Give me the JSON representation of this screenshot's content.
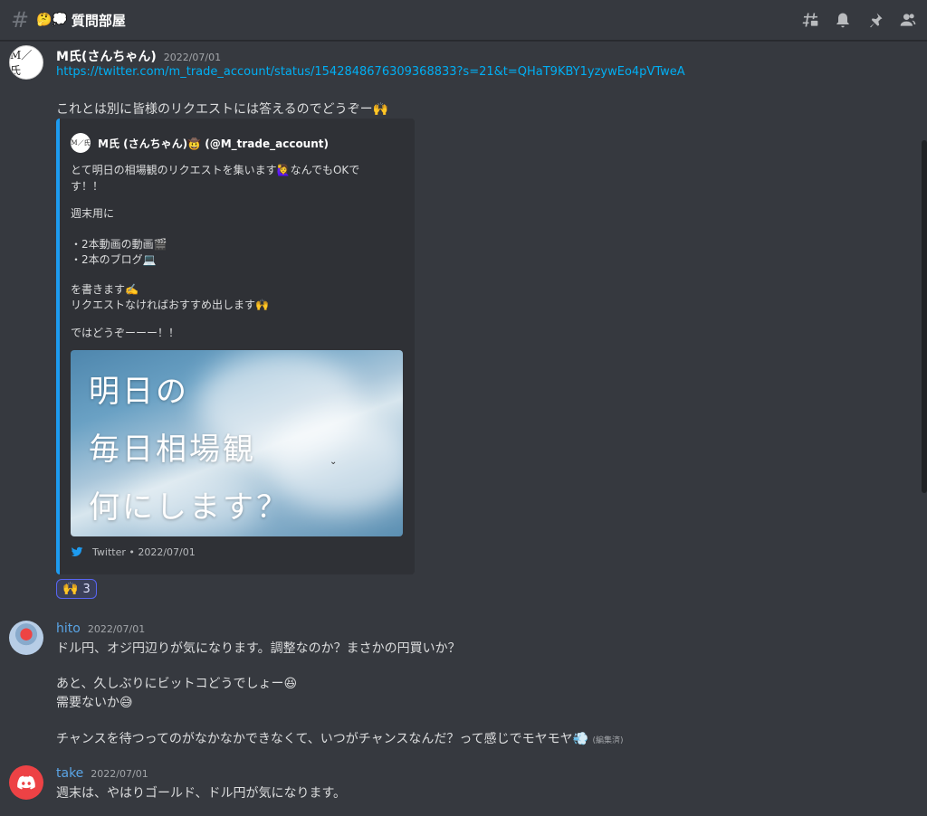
{
  "channel": {
    "emoji": "🤔💭",
    "name": "質問部屋"
  },
  "header_icons": [
    "threads-icon",
    "bell-icon",
    "pin-icon",
    "members-icon"
  ],
  "messages": [
    {
      "author": "M氏(さんちゃん)",
      "timestamp": "2022/07/01",
      "avatar_text": "M／氏",
      "link": "https://twitter.com/m_trade_account/status/1542848676309368833?s=21&t=QHaT9KBY1yzywEo4pVTweA",
      "text": "これとは別に皆様のリクエストには答えるのでどうぞー🙌",
      "embed": {
        "author": "M氏 (さんちゃん)🤠 (@M_trade_account)",
        "lines": [
          "とて明日の相場観のリクエストを集います🙋‍♀️なんでもOKで",
          "す！！",
          "",
          "週末用に",
          "",
          "・2本動画の動画🎬",
          "・2本のブログ💻",
          "",
          "を書きます✍️",
          "リクエストなければおすすめ出します🙌",
          "",
          "ではどうぞーーー！！"
        ],
        "image_text": [
          "明日の",
          "毎日相場観",
          "何にします？"
        ],
        "footer": "Twitter • 2022/07/01"
      },
      "reaction": {
        "emoji": "🙌",
        "count": "3"
      }
    },
    {
      "author": "hito",
      "timestamp": "2022/07/01",
      "lines": [
        "ドル円、オジ円辺りが気になります。調整なのか？まさかの円買いか？",
        "",
        "あと、久しぶりにビットコどうでしょー😆",
        "需要ないか😅",
        "",
        "チャンスを待つってのがなかなかできなくて、いつがチャンスなんだ？って感じでモヤモヤ💨"
      ],
      "edited": "(編集済)"
    },
    {
      "author": "take",
      "timestamp": "2022/07/01",
      "lines": [
        "週末は、やはりゴールド、ドル円が気になります。"
      ]
    }
  ]
}
